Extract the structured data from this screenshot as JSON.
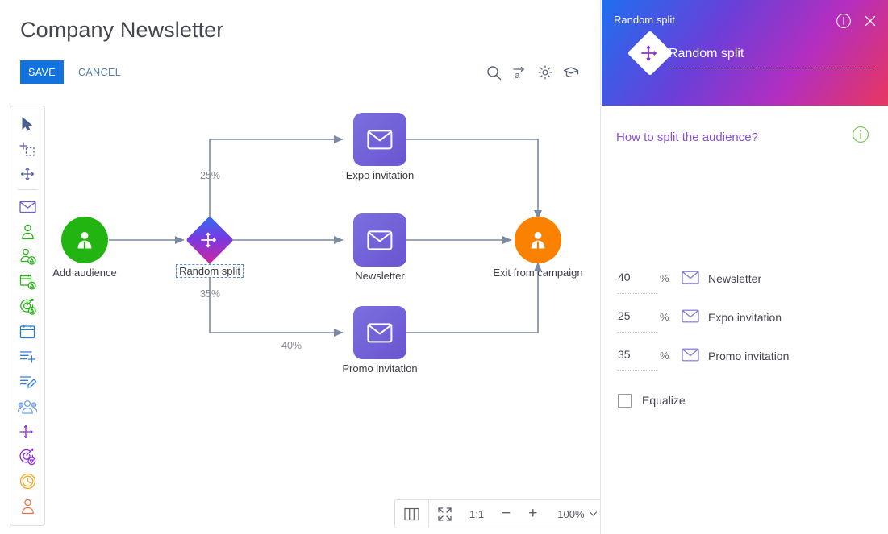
{
  "header": {
    "title": "Company Newsletter",
    "save_label": "SAVE",
    "cancel_label": "CANCEL",
    "accent_color": "#1273de",
    "tools": [
      {
        "name": "search-icon",
        "label": "Search"
      },
      {
        "name": "auto-name-icon",
        "label": "Auto name"
      },
      {
        "name": "gear-icon",
        "label": "Settings"
      },
      {
        "name": "graduation-cap-icon",
        "label": "Tutorial"
      }
    ]
  },
  "left_toolbar": {
    "items": [
      {
        "name": "cursor-select-icon",
        "label": "Select"
      },
      {
        "name": "add-selection-icon",
        "label": "Add selection"
      },
      {
        "name": "pan-move-icon",
        "label": "Move"
      },
      {
        "name": "email-icon",
        "label": "Email"
      },
      {
        "name": "audience-icon",
        "label": "Audience"
      },
      {
        "name": "audience-condition-icon",
        "label": "Audience condition"
      },
      {
        "name": "calendar-condition-icon",
        "label": "Date condition"
      },
      {
        "name": "goal-condition-icon",
        "label": "Goal condition"
      },
      {
        "name": "calendar-icon",
        "label": "Date"
      },
      {
        "name": "add-list-icon",
        "label": "Add to list"
      },
      {
        "name": "edit-list-icon",
        "label": "Edit list"
      },
      {
        "name": "group-icon",
        "label": "Group"
      },
      {
        "name": "random-split-icon",
        "label": "Random split"
      },
      {
        "name": "goal-icon",
        "label": "Goal"
      },
      {
        "name": "wait-clock-icon",
        "label": "Wait"
      },
      {
        "name": "exit-person-icon",
        "label": "Exit from campaign"
      }
    ]
  },
  "diagram": {
    "nodes": [
      {
        "id": "add-audience",
        "type": "audience",
        "label": "Add audience",
        "color": "#22b512"
      },
      {
        "id": "random-split",
        "type": "split",
        "label": "Random split",
        "selected": true
      },
      {
        "id": "expo-invitation",
        "type": "email",
        "label": "Expo invitation",
        "color": "#6f5ed6"
      },
      {
        "id": "newsletter",
        "type": "email",
        "label": "Newsletter",
        "color": "#6f5ed6"
      },
      {
        "id": "promo-invitation",
        "type": "email",
        "label": "Promo invitation",
        "color": "#6f5ed6"
      },
      {
        "id": "exit-from-campaign",
        "type": "exit",
        "label": "Exit from campaign",
        "color": "#fb8101"
      }
    ],
    "edge_labels": [
      {
        "id": "edge-pct-expo",
        "value": "25%"
      },
      {
        "id": "edge-pct-newsletter",
        "value": "40%"
      },
      {
        "id": "edge-pct-promo",
        "value": "35%"
      }
    ],
    "edge_color": "#7a8aa0"
  },
  "zoom_bar": {
    "columns_label": "",
    "fit_label": "",
    "one_to_one_label": "1:1",
    "minus_label": "−",
    "plus_label": "+",
    "zoom_level": "100%"
  },
  "panel": {
    "header_title": "Random split",
    "node_name_value": "Random split",
    "info_icon": "info-icon",
    "close_icon": "close-icon",
    "gradient_start": "#1f6ff0",
    "gradient_end": "#e8365f",
    "split_heading": "How to split the audience?",
    "split_heading_color": "#8a4fe0",
    "split_rows": [
      {
        "percent": "40",
        "sign": "%",
        "target": "Newsletter"
      },
      {
        "percent": "25",
        "sign": "%",
        "target": "Expo invitation"
      },
      {
        "percent": "35",
        "sign": "%",
        "target": "Promo invitation"
      }
    ],
    "equalize_label": "Equalize",
    "equalize_checked": false
  }
}
